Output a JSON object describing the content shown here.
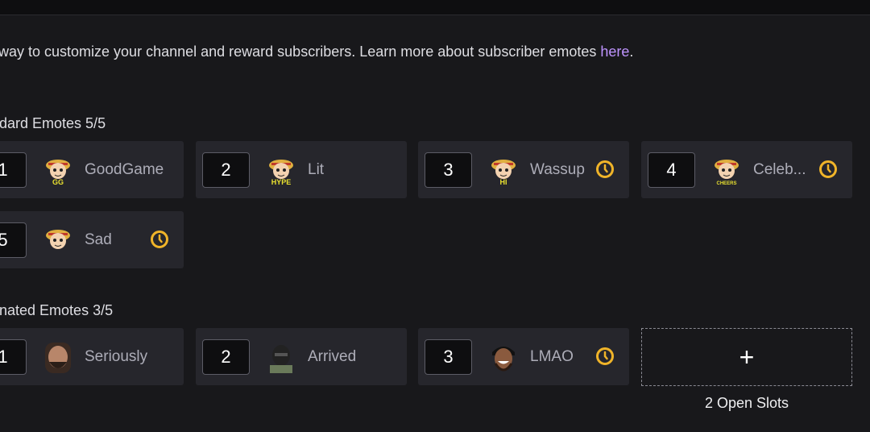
{
  "description": {
    "text": "way to customize your channel and reward subscribers. Learn more about subscriber emotes ",
    "link": "here",
    "end": "."
  },
  "standard": {
    "heading": "dard Emotes 5/5",
    "items": [
      {
        "slot": "1",
        "name": "GoodGame",
        "badge": "GG",
        "pending": false
      },
      {
        "slot": "2",
        "name": "Lit",
        "badge": "HYPE",
        "pending": false
      },
      {
        "slot": "3",
        "name": "Wassup",
        "badge": "HI",
        "pending": true
      },
      {
        "slot": "4",
        "name": "Celeb...",
        "badge": "CHEERS",
        "pending": true
      },
      {
        "slot": "5",
        "name": "Sad",
        "badge": "",
        "pending": true
      }
    ]
  },
  "animated": {
    "heading": "nated Emotes 3/5",
    "items": [
      {
        "slot": "1",
        "name": "Seriously",
        "pending": false
      },
      {
        "slot": "2",
        "name": "Arrived",
        "pending": false
      },
      {
        "slot": "3",
        "name": "LMAO",
        "pending": true
      }
    ],
    "add_icon": "+",
    "open_slots": "2 Open Slots"
  },
  "colors": {
    "link": "#bf94ff",
    "pending_clock": "#f0b429",
    "card": "#26262c"
  }
}
